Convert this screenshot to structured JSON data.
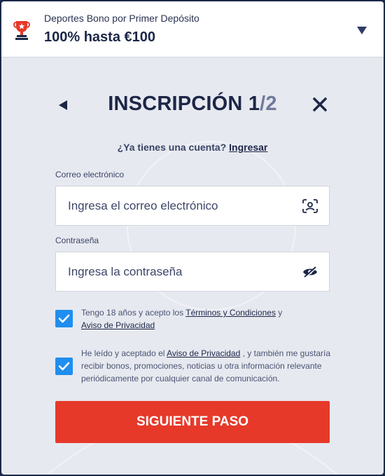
{
  "bonus": {
    "subtitle": "Deportes Bono por Primer Depósito",
    "amount": "100% hasta €100"
  },
  "signup": {
    "title": "INSCRIPCIÓN 1",
    "step_total": "/2",
    "has_account": "¿Ya tienes una cuenta?",
    "login_link": "Ingresar"
  },
  "email": {
    "label": "Correo electrónico",
    "placeholder": "Ingresa el correo electrónico"
  },
  "password": {
    "label": "Contraseña",
    "placeholder": "Ingresa la contraseña"
  },
  "consent_terms": {
    "text_before": "Tengo 18 años y acepto los",
    "terms_link": "Términos y Condiciones",
    "text_and": "y",
    "privacy_link": "Aviso de Privacidad",
    "checked": true
  },
  "consent_marketing": {
    "text_before": "He leído y aceptado el",
    "privacy_link": "Aviso de Privacidad",
    "text_after": ", y también me gustaría recibir bonos, promociones, noticias u otra información relevante periódicamente por cualquier canal de comunicación.",
    "checked": true
  },
  "next_button": "SIGUIENTE PASO",
  "colors": {
    "primary_navy": "#1c2647",
    "accent_red": "#e6392a",
    "checkbox_blue": "#1f8ef0",
    "modal_bg": "#e7e9f0"
  },
  "icons": {
    "bonus": "trophy-icon",
    "back": "back-arrow-icon",
    "close": "close-icon",
    "email_field": "face-scan-icon",
    "password_field": "eye-hidden-icon",
    "checkbox": "checkmark-icon"
  }
}
